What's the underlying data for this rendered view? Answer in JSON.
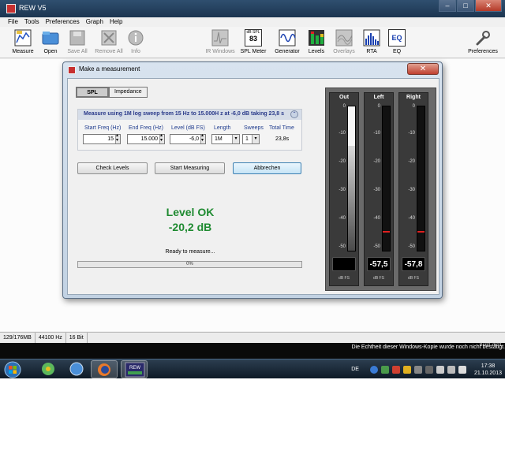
{
  "window": {
    "title": "REW V5",
    "min": "–",
    "max": "□",
    "close": "✕"
  },
  "menu": [
    "File",
    "Tools",
    "Preferences",
    "Graph",
    "Help"
  ],
  "toolbar": {
    "measure": "Measure",
    "open": "Open",
    "save_all": "Save All",
    "remove_all": "Remove All",
    "info": "Info",
    "ir_windows": "IR Windows",
    "spl_meter": "SPL Meter",
    "spl_meter_icon_label": "dB SPL",
    "spl_meter_icon_value": "83",
    "generator": "Generator",
    "levels": "Levels",
    "overlays": "Overlays",
    "rta": "RTA",
    "eq": "EQ",
    "eq_icon_label": "EQ",
    "preferences": "Preferences"
  },
  "dialog": {
    "title": "Make a measurement",
    "close": "✕",
    "tabs": [
      "SPL",
      "Impedance"
    ],
    "summary": "Measure using   1M log sweep from 15 Hz to 15.000H z at -6,0 dB taking 23,8 s",
    "collapse": "⌃",
    "fields": {
      "start_freq_label": "Start Freq (Hz)",
      "start_freq": "15",
      "end_freq_label": "End Freq (Hz)",
      "end_freq": "15.000",
      "level_label": "Level (dB FS)",
      "level": "-6,0",
      "length_label": "Length",
      "length": "1M",
      "sweeps_label": "Sweeps",
      "sweeps": "1",
      "total_time_label": "Total Time",
      "total_time": "23,8s"
    },
    "buttons": {
      "check_levels": "Check Levels",
      "start_measuring": "Start Measuring",
      "cancel": "Abbrechen"
    },
    "status_line1": "Level OK",
    "status_line2": "-20,2 dB",
    "ready": "Ready to measure...",
    "progress": {
      "value": 0,
      "label": "0%"
    }
  },
  "meters": {
    "scale": [
      "0",
      "-10",
      "-20",
      "-30",
      "-40",
      "-50"
    ],
    "unit": "dB FS",
    "out": {
      "title": "Out",
      "readout": ""
    },
    "left": {
      "title": "Left",
      "readout": "-57,5",
      "peak_db": -45
    },
    "right": {
      "title": "Right",
      "readout": "-57,8",
      "peak_db": -45
    }
  },
  "statusbar": {
    "memory": "129/176MB",
    "rate": "44100 Hz",
    "bits": "16 Bit"
  },
  "desktop": {
    "build": "Build 7601",
    "watermark": "Die Echtheit dieser Windows-Kopie wurde noch nicht bestätigt."
  },
  "taskbar": {
    "lang": "DE",
    "time": "17:38",
    "date": "21.10.2013",
    "rew_label": "REW"
  }
}
